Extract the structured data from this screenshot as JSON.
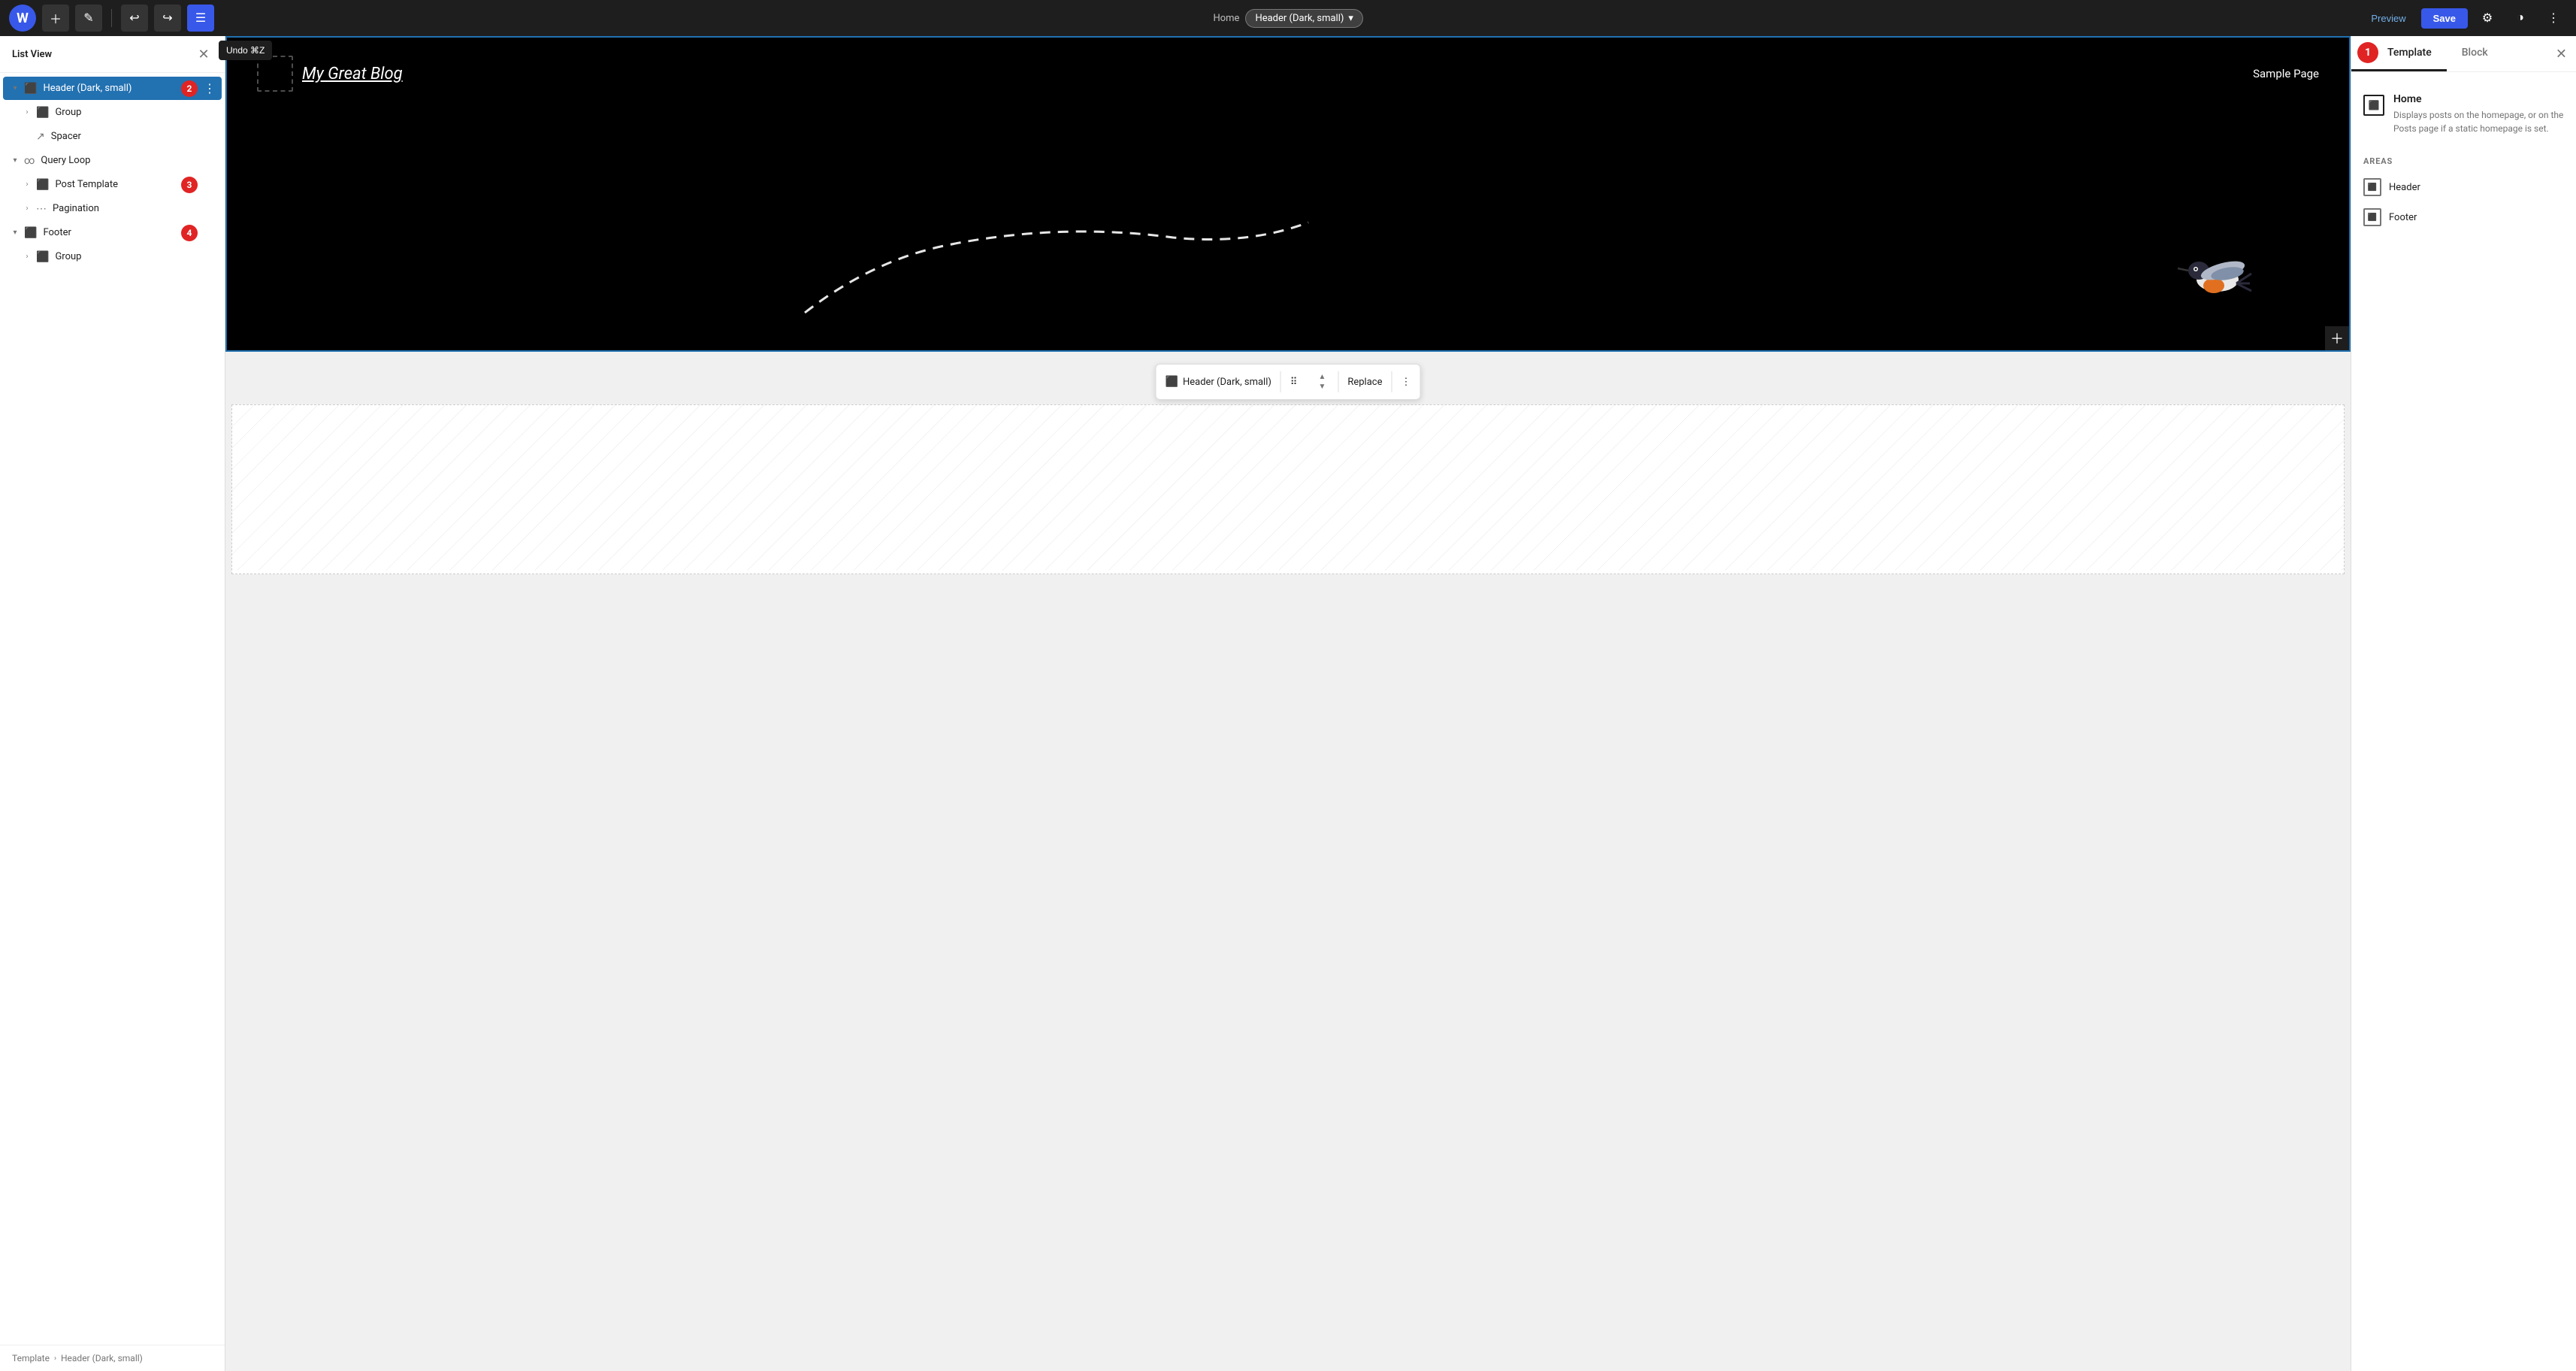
{
  "toolbar": {
    "wp_logo": "W",
    "undo_label": "Undo ⌘Z",
    "breadcrumb_home": "Home",
    "breadcrumb_current": "Header (Dark, small)",
    "preview_label": "Preview",
    "save_label": "Save"
  },
  "sidebar": {
    "title": "List View",
    "items": [
      {
        "id": "header",
        "label": "Header (Dark, small)",
        "indent": 0,
        "has_children": true,
        "open": true,
        "badge": "2",
        "selected": true
      },
      {
        "id": "group1",
        "label": "Group",
        "indent": 1,
        "has_children": true,
        "open": false
      },
      {
        "id": "spacer",
        "label": "Spacer",
        "indent": 1,
        "has_children": false,
        "icon": "↗"
      },
      {
        "id": "query-loop",
        "label": "Query Loop",
        "indent": 0,
        "has_children": true,
        "open": true
      },
      {
        "id": "post-template",
        "label": "Post Template",
        "indent": 1,
        "has_children": true,
        "open": false,
        "badge": "3"
      },
      {
        "id": "pagination",
        "label": "Pagination",
        "indent": 1,
        "has_children": true,
        "open": false
      },
      {
        "id": "footer",
        "label": "Footer",
        "indent": 0,
        "has_children": true,
        "open": true,
        "badge": "4"
      },
      {
        "id": "group2",
        "label": "Group",
        "indent": 1,
        "has_children": true,
        "open": false
      }
    ],
    "footer_breadcrumb": "Template",
    "footer_current": "Header (Dark, small)"
  },
  "canvas": {
    "site_title": "My Great Blog",
    "nav_label": "Sample Page",
    "floating_toolbar": {
      "block_icon": "▦",
      "block_label": "Header (Dark, small)",
      "replace_label": "Replace"
    }
  },
  "right_panel": {
    "tabs": [
      "Template",
      "Block"
    ],
    "active_tab": "Template",
    "badge": "1",
    "template": {
      "item_icon": "▦",
      "item_title": "Home",
      "item_desc": "Displays posts on the homepage, or on the Posts page if a static homepage is set.",
      "areas_label": "AREAS",
      "areas": [
        {
          "label": "Header"
        },
        {
          "label": "Footer"
        }
      ]
    }
  }
}
